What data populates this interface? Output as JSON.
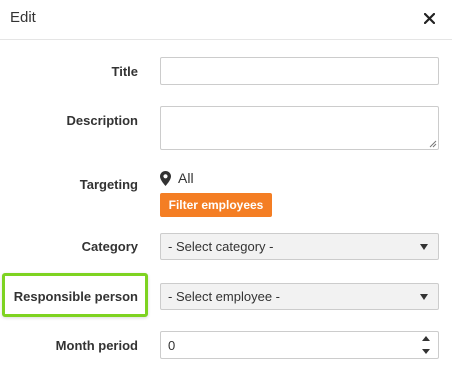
{
  "header": {
    "title": "Edit"
  },
  "form": {
    "title_label": "Title",
    "title_value": "",
    "description_label": "Description",
    "description_value": "",
    "targeting_label": "Targeting",
    "targeting_value": "All",
    "filter_button_label": "Filter employees",
    "category_label": "Category",
    "category_selected": "- Select category -",
    "responsible_label": "Responsible person",
    "responsible_selected": "- Select employee -",
    "month_period_label": "Month period",
    "month_period_value": "0"
  },
  "colors": {
    "accent_button": "#f47e24",
    "highlight": "#7ed321"
  },
  "icons": {
    "close": "close-icon",
    "targeting": "map-pin-icon",
    "select_caret": "caret-down-icon",
    "spinner_up": "chevron-up-icon",
    "spinner_down": "chevron-down-icon"
  }
}
